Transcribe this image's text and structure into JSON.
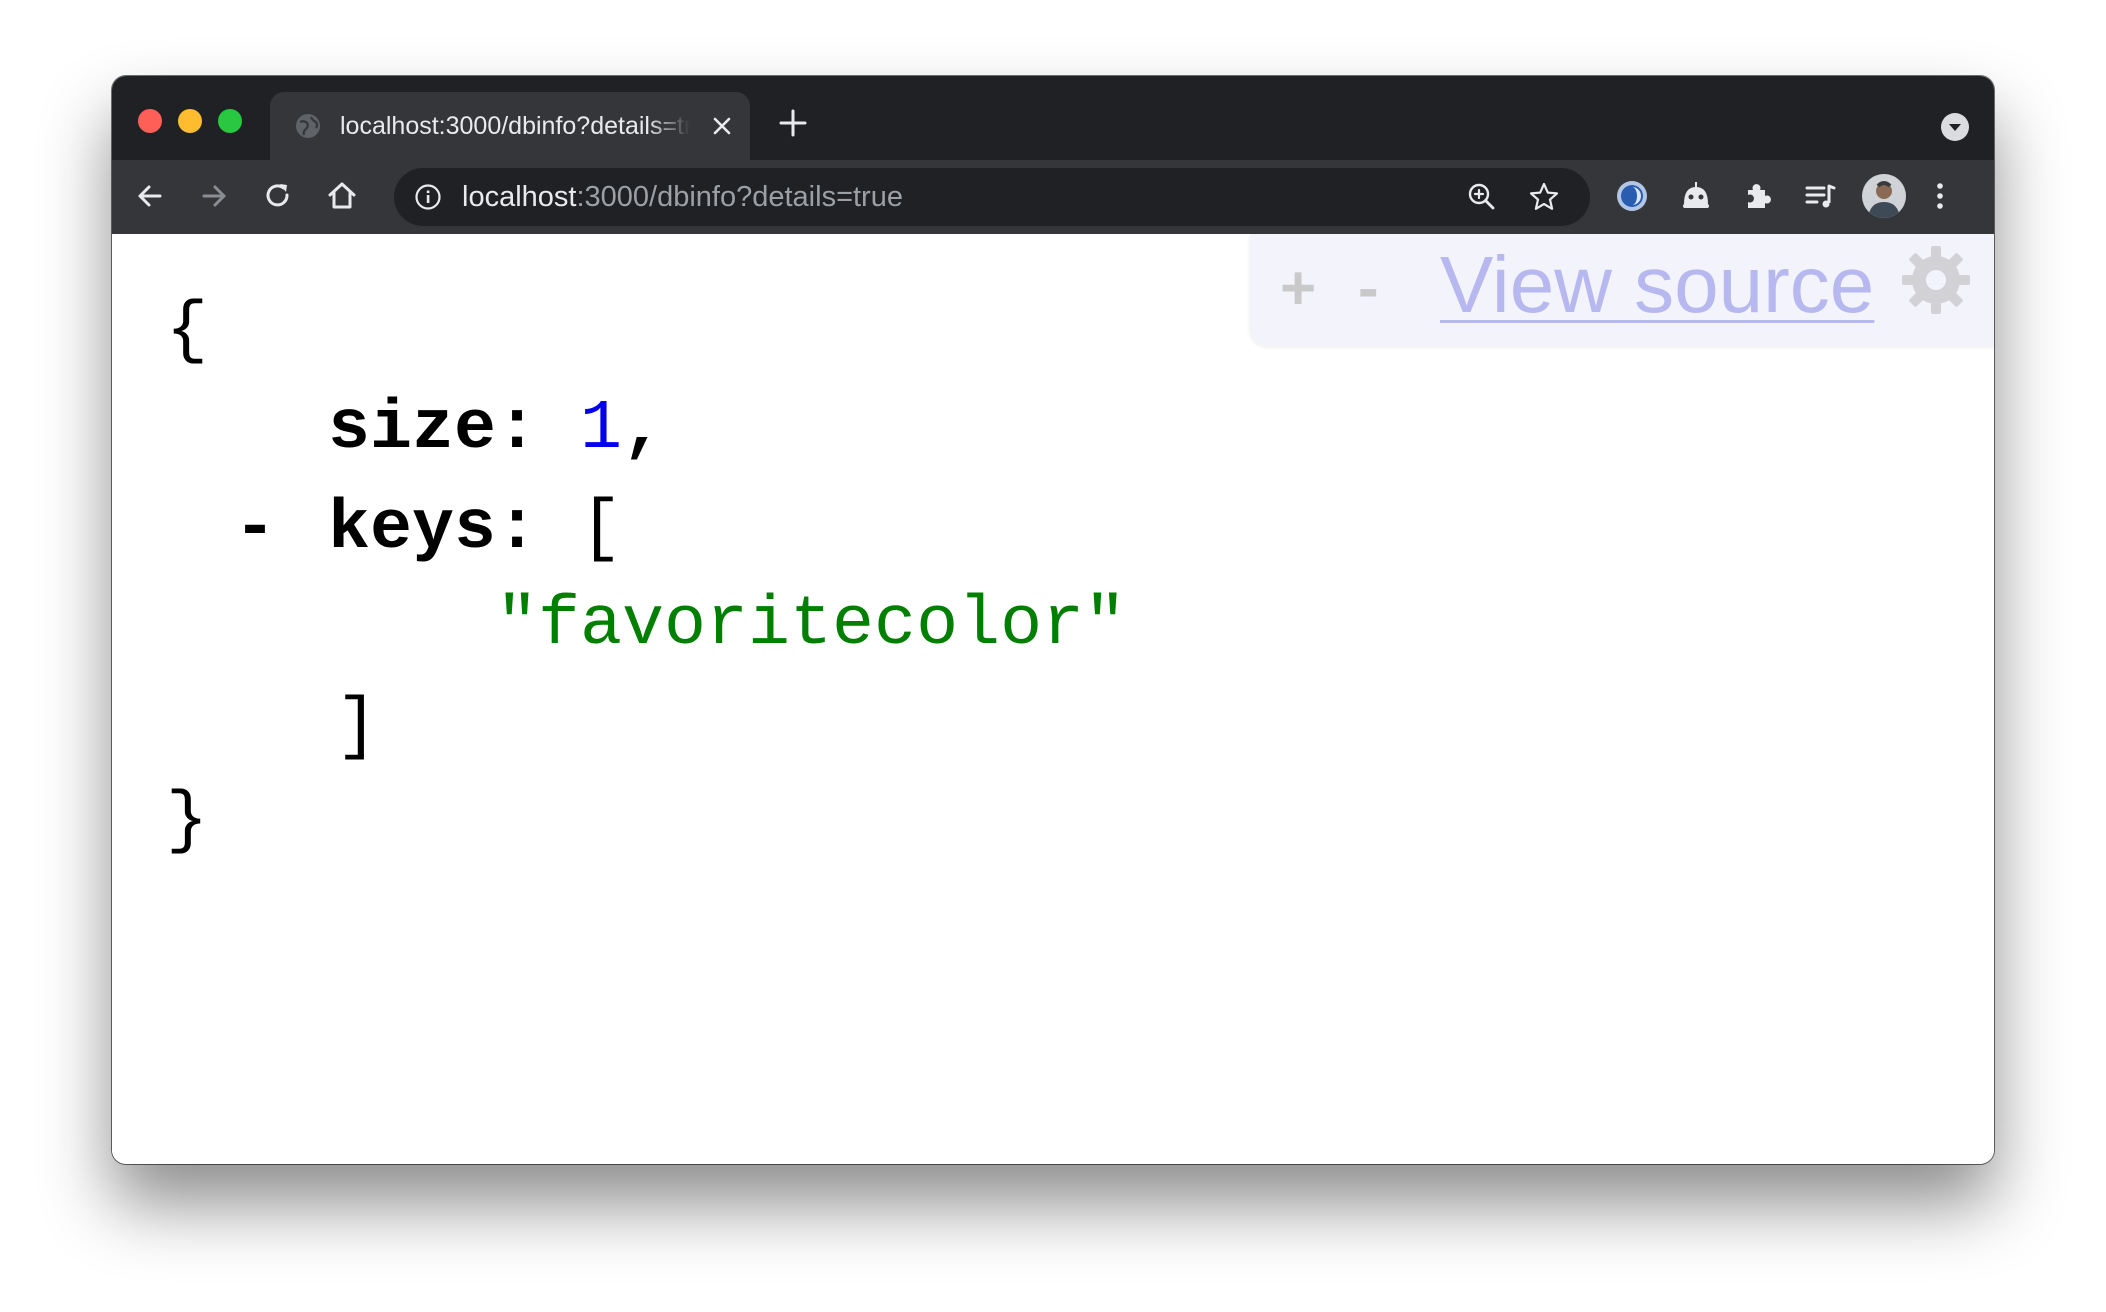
{
  "tab": {
    "title": "localhost:3000/dbinfo?details=true"
  },
  "omnibox": {
    "url_host": "localhost",
    "url_rest": ":3000/dbinfo?details=true"
  },
  "toolbar_icons": [
    "back-arrow-icon",
    "forward-arrow-icon",
    "reload-icon",
    "home-icon"
  ],
  "extension_icons": [
    "blue-circle-extension-icon",
    "robot-extension-icon",
    "puzzle-extensions-icon",
    "media-queue-icon"
  ],
  "json_viewer": {
    "toolbar": {
      "expand_label": "+",
      "collapse_label": "-",
      "view_source_label": "View source"
    },
    "lines": {
      "open_brace": "{",
      "size_key": "size",
      "size_colon": ": ",
      "size_value": "1",
      "size_comma": ",",
      "keys_toggle": "-",
      "keys_key": "keys",
      "keys_colon": ": ",
      "keys_open_bracket": "[",
      "keys_item_0": "\"favoritecolor\"",
      "keys_close_bracket": "]",
      "close_brace": "}"
    }
  },
  "colors": {
    "number": "#0000ee",
    "string": "#007f00",
    "toolbar_bg": "#35363a",
    "tabstrip_bg": "#202124",
    "view_source_link": "#b8b8f0"
  }
}
